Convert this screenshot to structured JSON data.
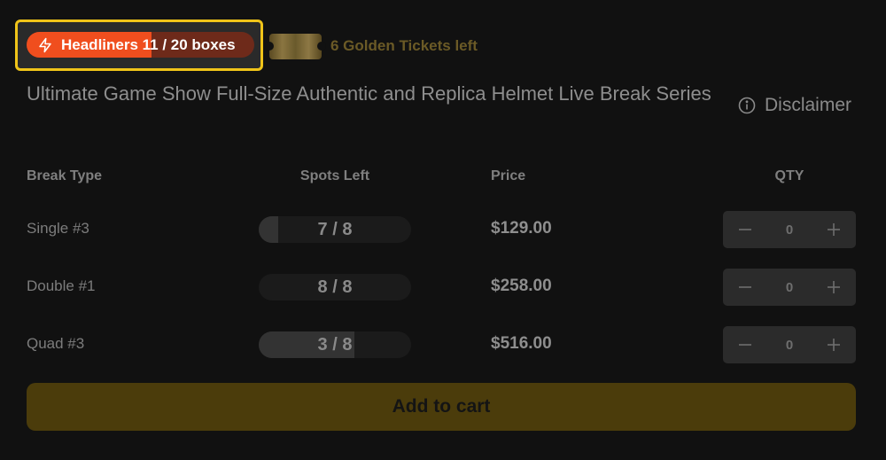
{
  "headliner": {
    "label": "Headliners 11 / 20 boxes",
    "progress": 0.55,
    "icon": "lightning-bolt-icon",
    "highlight_color": "#f0c419",
    "fill_color": "#f04e1e"
  },
  "golden_tickets": {
    "label": "6 Golden Tickets left",
    "icon": "golden-ticket-icon",
    "color": "#6b5a26"
  },
  "product": {
    "title": "Ultimate Game Show Full-Size Authentic and Replica Helmet Live Break Series"
  },
  "disclaimer": {
    "label": "Disclaimer",
    "icon": "info-circle-icon"
  },
  "table": {
    "headers": {
      "type": "Break Type",
      "spots": "Spots Left",
      "price": "Price",
      "qty": "QTY"
    },
    "rows": [
      {
        "type": "Single #3",
        "spots": "7 / 8",
        "spots_filled_fraction": 0.125,
        "price": "$129.00",
        "qty": "0"
      },
      {
        "type": "Double #1",
        "spots": "8 / 8",
        "spots_filled_fraction": 0.0,
        "price": "$258.00",
        "qty": "0"
      },
      {
        "type": "Quad #3",
        "spots": "3 / 8",
        "spots_filled_fraction": 0.625,
        "price": "$516.00",
        "qty": "0"
      }
    ],
    "qty_icons": {
      "decrement": "minus-icon",
      "increment": "plus-icon"
    }
  },
  "cart": {
    "add_label": "Add to cart",
    "button_color": "#4b3c0b"
  }
}
